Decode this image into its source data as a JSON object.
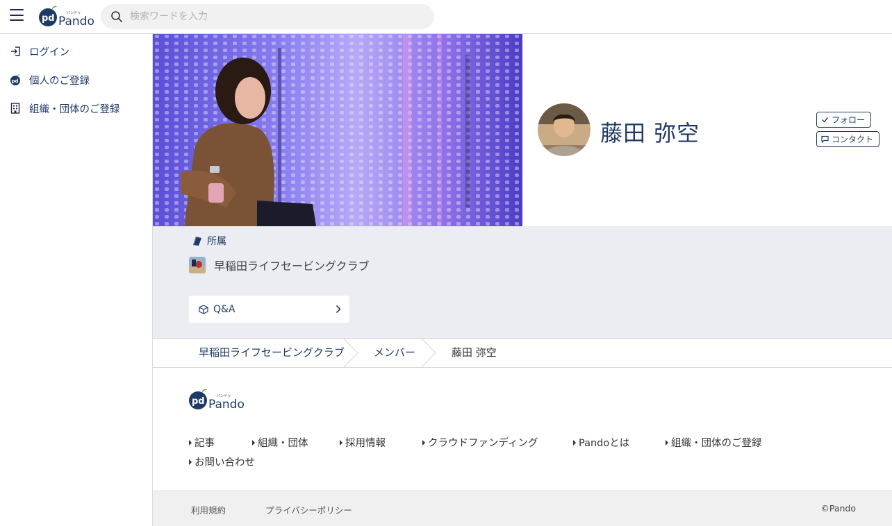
{
  "header": {
    "logo_text": "Pando",
    "logo_ruby": "パンドゥ",
    "search_placeholder": "検索ワードを入力"
  },
  "sidebar": {
    "items": [
      {
        "label": "ログイン",
        "icon": "login-icon"
      },
      {
        "label": "個人のご登録",
        "icon": "pando-pd-icon"
      },
      {
        "label": "組織・団体のご登録",
        "icon": "building-icon"
      }
    ]
  },
  "profile": {
    "name": "藤田 弥空",
    "follow_label": "フォロー",
    "contact_label": "コンタクト"
  },
  "affiliation": {
    "heading": "所属",
    "org_name": "早稲田ライフセービングクラブ",
    "qa_label": "Q&A"
  },
  "breadcrumb": {
    "items": [
      "早稲田ライフセービングクラブ",
      "メンバー",
      "藤田 弥空"
    ]
  },
  "footer": {
    "logo_text": "Pando",
    "links": [
      "記事",
      "組織・団体",
      "採用情報",
      "クラウドファンディング",
      "Pandoとは",
      "組織・団体のご登録",
      "お問い合わせ"
    ],
    "terms": "利用規約",
    "privacy": "プライバシーポリシー",
    "copyright": "©Pando"
  },
  "colors": {
    "brand_navy": "#1e3a66",
    "band_bg": "#ebedf2",
    "leaf_green": "#6aa84f"
  }
}
